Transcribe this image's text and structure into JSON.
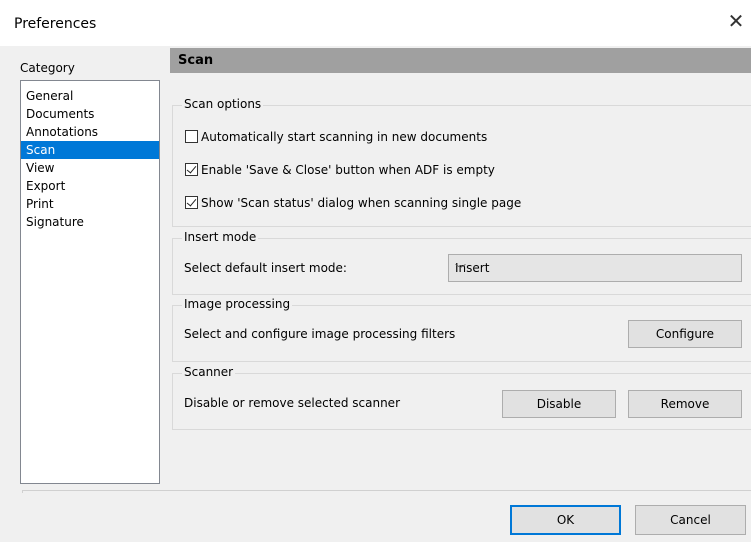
{
  "window": {
    "title": "Preferences",
    "close_glyph": "✕"
  },
  "sidebar": {
    "heading": "Category",
    "items": [
      {
        "label": "General",
        "selected": false
      },
      {
        "label": "Documents",
        "selected": false
      },
      {
        "label": "Annotations",
        "selected": false
      },
      {
        "label": "Scan",
        "selected": true
      },
      {
        "label": "View",
        "selected": false
      },
      {
        "label": "Export",
        "selected": false
      },
      {
        "label": "Print",
        "selected": false
      },
      {
        "label": "Signature",
        "selected": false
      }
    ]
  },
  "panel": {
    "header": "Scan",
    "scan_options": {
      "title": "Scan options",
      "checkboxes": [
        {
          "label": "Automatically start scanning in new documents",
          "checked": false
        },
        {
          "label": "Enable 'Save & Close' button when ADF is empty",
          "checked": true
        },
        {
          "label": "Show 'Scan status' dialog when scanning single page",
          "checked": true
        }
      ]
    },
    "insert_mode": {
      "title": "Insert mode",
      "label": "Select default insert mode:",
      "selected": "Insert",
      "chevron": "﹀"
    },
    "image_processing": {
      "title": "Image processing",
      "label": "Select and configure image processing filters",
      "button": "Configure"
    },
    "scanner": {
      "title": "Scanner",
      "label": "Disable or remove selected scanner",
      "disable_button": "Disable",
      "remove_button": "Remove"
    }
  },
  "footer": {
    "ok": "OK",
    "cancel": "Cancel"
  },
  "colors": {
    "selection": "#0078d7",
    "header_bar": "#a0a0a0",
    "window_bg": "#f0f0f0"
  }
}
